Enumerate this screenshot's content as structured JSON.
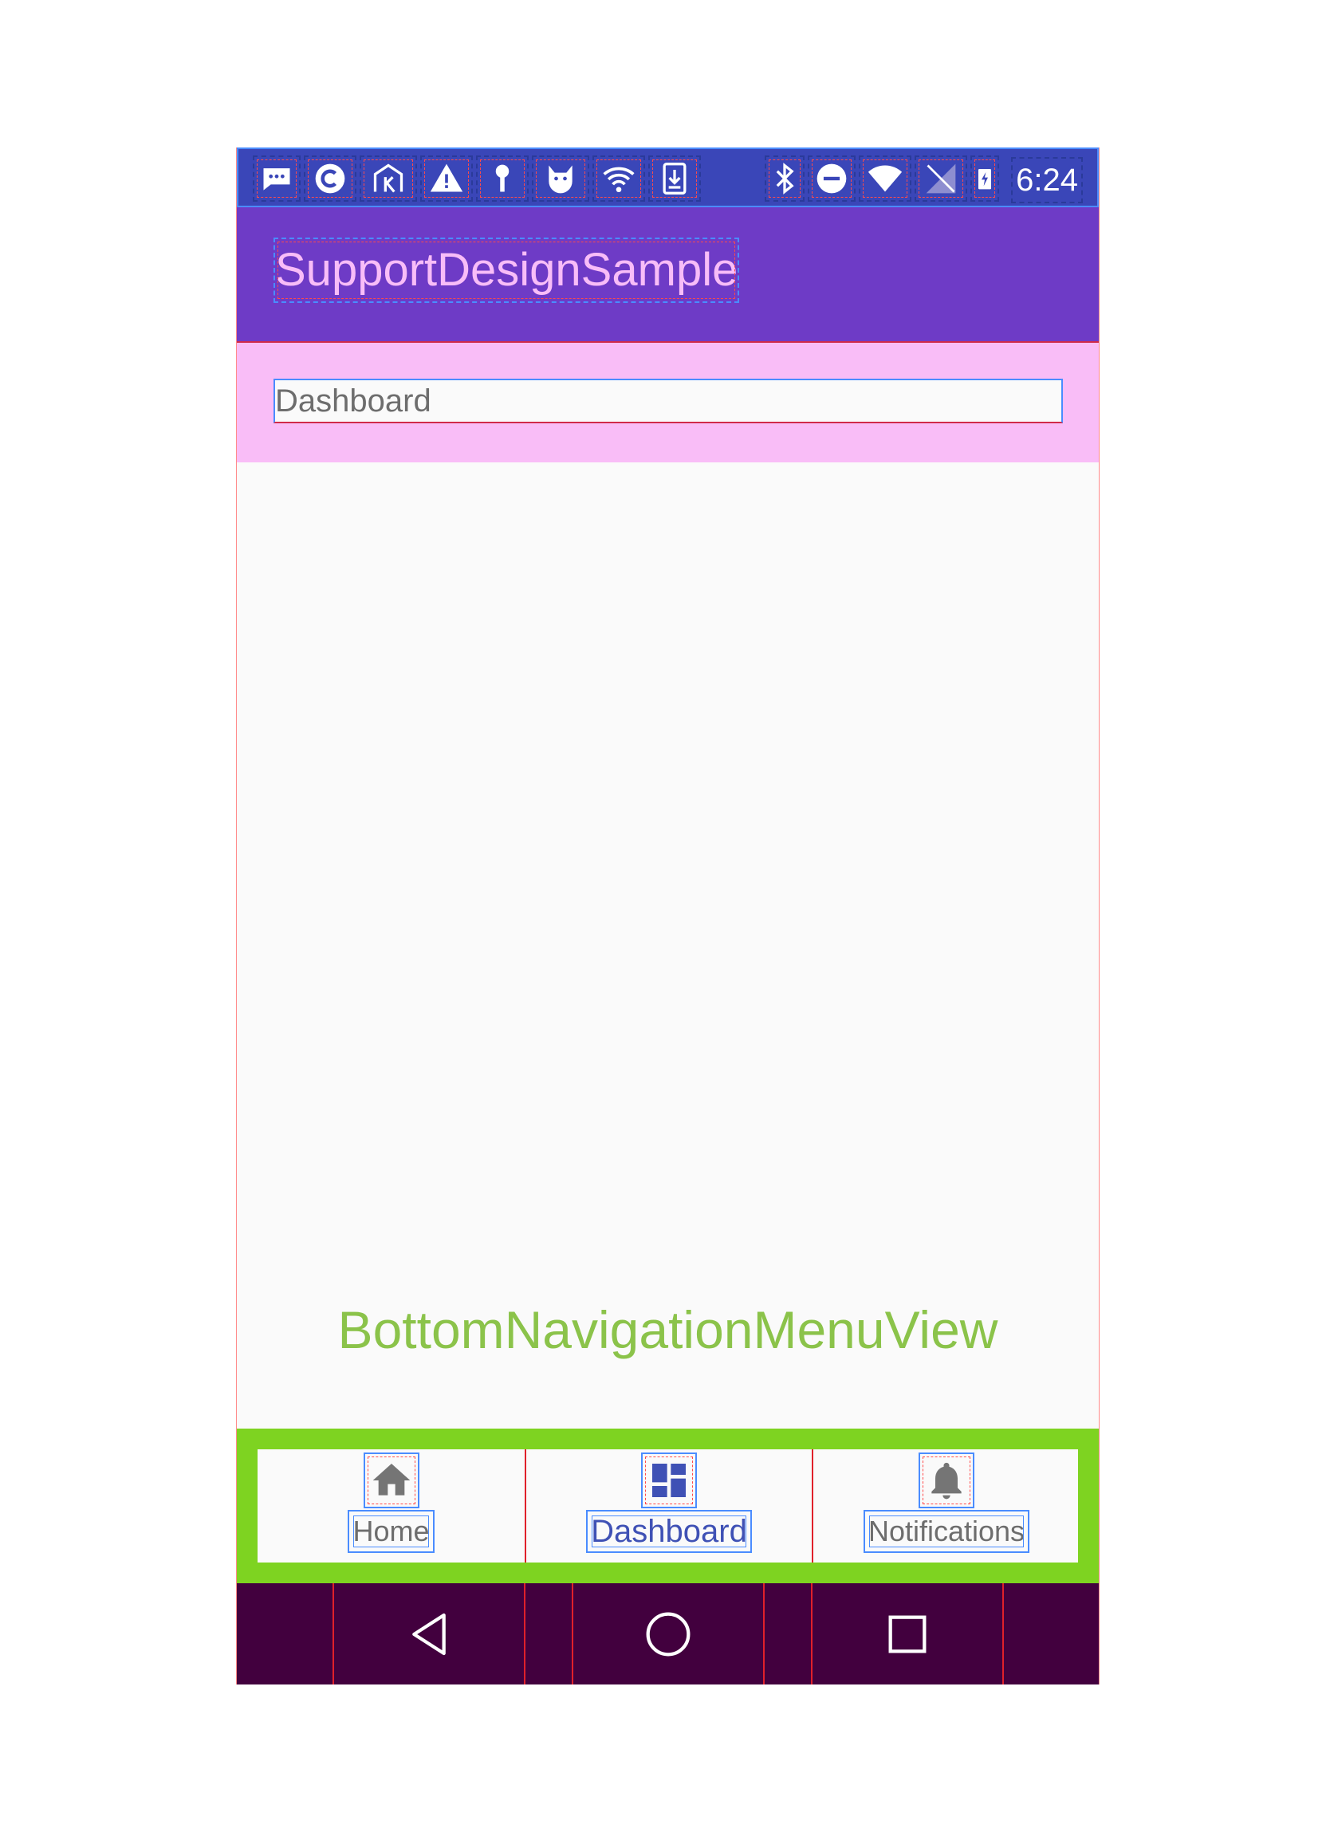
{
  "status_bar": {
    "time": "6:24",
    "left_icons": [
      "message-icon",
      "c-app-icon",
      "k-app-icon",
      "warning-icon",
      "key-icon",
      "cat-app-icon",
      "wifi-signal-icon",
      "download-icon"
    ],
    "right_icons": [
      "bluetooth-icon",
      "do-not-disturb-icon",
      "wifi-icon",
      "cell-signal-icon",
      "battery-charging-icon"
    ]
  },
  "app_bar": {
    "title": "SupportDesignSample"
  },
  "content": {
    "text_value": "Dashboard",
    "overlay_label": "BottomNavigationMenuView"
  },
  "bottom_nav": {
    "items": [
      {
        "label": "Home",
        "icon": "home-icon",
        "active": false
      },
      {
        "label": "Dashboard",
        "icon": "dashboard-icon",
        "active": true
      },
      {
        "label": "Notifications",
        "icon": "bell-icon",
        "active": false
      }
    ],
    "active_color": "#3f51b5",
    "inactive_color": "#6d6d6d"
  },
  "system_nav": {
    "buttons": [
      "back-icon",
      "home-circle-icon",
      "recents-icon"
    ]
  },
  "colors": {
    "status_bar": "#3a46b8",
    "app_bar": "#6e3bc6",
    "title_text": "#f8bdf8",
    "text_section_bg": "#f9bdf7",
    "bottom_nav_border": "#7ed321",
    "overlay_label": "#8bc34a",
    "system_nav": "#42003e"
  }
}
